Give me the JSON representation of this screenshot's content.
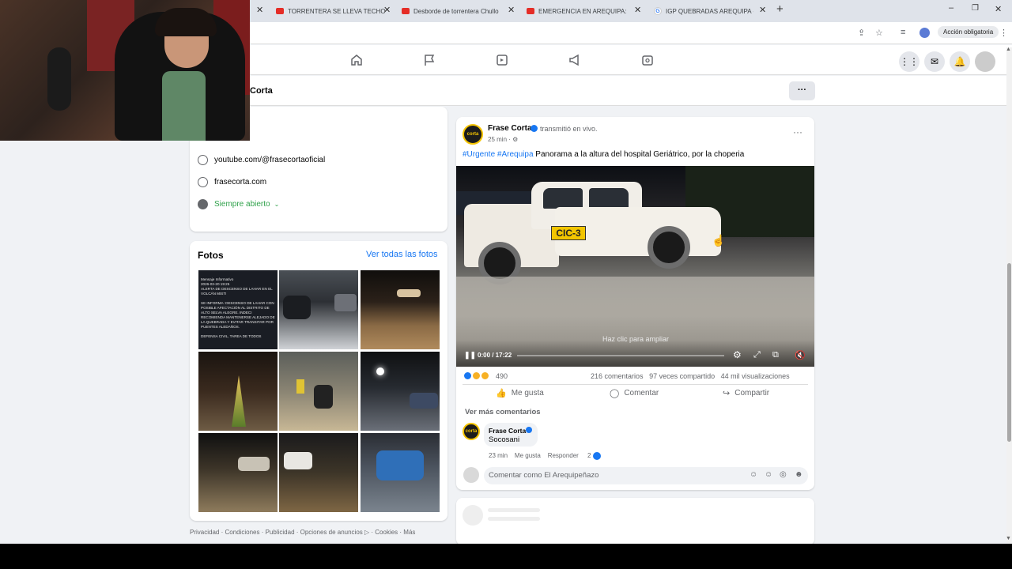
{
  "browser": {
    "tabs": [
      {
        "title": "TORRENTERA SE LLEVA TECHO",
        "icon": "youtube-icon"
      },
      {
        "title": "Desborde de torrentera Chullo",
        "icon": "youtube-icon"
      },
      {
        "title": "EMERGENCIA EN AREQUIPA: LL",
        "icon": "youtube-icon"
      },
      {
        "title": "IGP QUEBRADAS AREQUIPA - B",
        "icon": "google-icon"
      }
    ],
    "required_action": "Acción obligatoria"
  },
  "page": {
    "name_partial": "Corta"
  },
  "intro": {
    "youtube": "youtube.com/@frasecortaoficial",
    "website": "frasecorta.com",
    "hours": "Siempre abierto"
  },
  "photos": {
    "title": "Fotos",
    "see_all": "Ver todas las fotos",
    "first_thumb_text": "Mensaje Informativo\n2026-03-20 19:25\nALERTA DE DESCENSO DE LAHAR EN EL VOLCÁN MISTI\n\nSE INFORMA: DESCENSO DE LAHAR CON POSIBLE AFECTACIÓN AL DISTRITO DE ALTO SELVA ALEGRE. INDECI RECOMIENDA MANTENERSE ALEJADO DE LA QUEBRADA Y EVITAR TRANSITAR POR PUENTES ALEDAÑOS.\n\nDEFENSA CIVIL, TAREA DE TODOS"
  },
  "footer": {
    "links": "Privacidad · Condiciones · Publicidad · Opciones de anuncios ▷ · Cookies · Más"
  },
  "post": {
    "author": "Frase Corta",
    "action": "transmitió en vivo.",
    "time": "25 min ·",
    "hashtag1": "#Urgente",
    "hashtag2": "#Arequipa",
    "text": "Panorama a la altura del hospital Geriátrico, por la choperia",
    "video": {
      "zoom_hint": "Haz clic para ampliar",
      "time": "0:00 / 17:22",
      "progress": 0.0,
      "truck_label": "CIC-3"
    },
    "reactions_count": "490",
    "comments_count": "216 comentarios",
    "shares_count": "97 veces compartido",
    "views_count": "44 mil visualizaciones",
    "actions": {
      "like": "Me gusta",
      "comment": "Comentar",
      "share": "Compartir"
    },
    "more_comments": "Ver más comentarios",
    "comment": {
      "author": "Frase Corta",
      "text": "Socosani",
      "time": "23 min",
      "like": "Me gusta",
      "reply": "Responder",
      "likes": "2"
    },
    "composer_placeholder": "Comentar como El Arequipeñazo",
    "avatar_text": "corta"
  },
  "colors": {
    "accent": "#1877f2",
    "green": "#31a24c",
    "background": "#f0f2f5"
  }
}
